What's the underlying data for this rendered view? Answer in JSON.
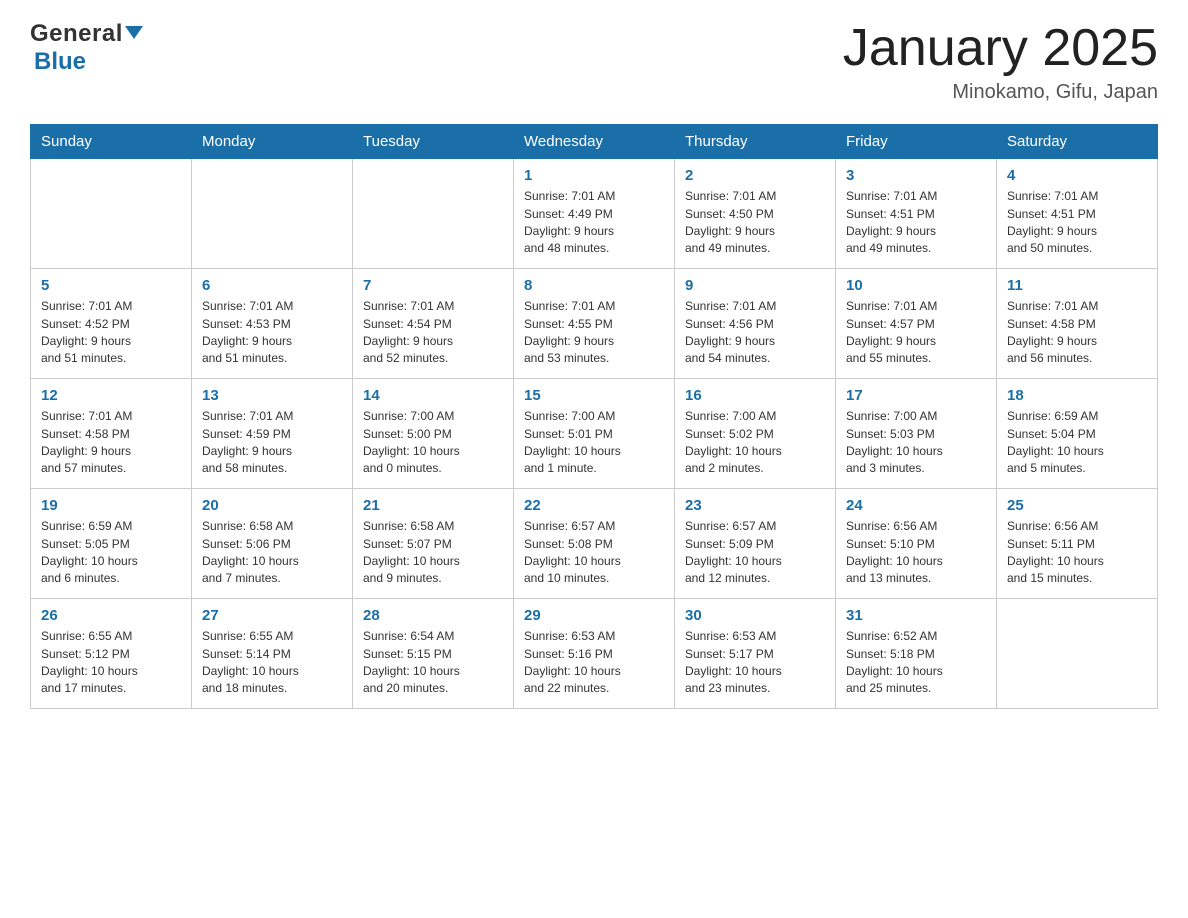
{
  "header": {
    "logo_general": "General",
    "logo_blue": "Blue",
    "title": "January 2025",
    "subtitle": "Minokamo, Gifu, Japan"
  },
  "days_of_week": [
    "Sunday",
    "Monday",
    "Tuesday",
    "Wednesday",
    "Thursday",
    "Friday",
    "Saturday"
  ],
  "weeks": [
    [
      {
        "day": "",
        "info": ""
      },
      {
        "day": "",
        "info": ""
      },
      {
        "day": "",
        "info": ""
      },
      {
        "day": "1",
        "info": "Sunrise: 7:01 AM\nSunset: 4:49 PM\nDaylight: 9 hours\nand 48 minutes."
      },
      {
        "day": "2",
        "info": "Sunrise: 7:01 AM\nSunset: 4:50 PM\nDaylight: 9 hours\nand 49 minutes."
      },
      {
        "day": "3",
        "info": "Sunrise: 7:01 AM\nSunset: 4:51 PM\nDaylight: 9 hours\nand 49 minutes."
      },
      {
        "day": "4",
        "info": "Sunrise: 7:01 AM\nSunset: 4:51 PM\nDaylight: 9 hours\nand 50 minutes."
      }
    ],
    [
      {
        "day": "5",
        "info": "Sunrise: 7:01 AM\nSunset: 4:52 PM\nDaylight: 9 hours\nand 51 minutes."
      },
      {
        "day": "6",
        "info": "Sunrise: 7:01 AM\nSunset: 4:53 PM\nDaylight: 9 hours\nand 51 minutes."
      },
      {
        "day": "7",
        "info": "Sunrise: 7:01 AM\nSunset: 4:54 PM\nDaylight: 9 hours\nand 52 minutes."
      },
      {
        "day": "8",
        "info": "Sunrise: 7:01 AM\nSunset: 4:55 PM\nDaylight: 9 hours\nand 53 minutes."
      },
      {
        "day": "9",
        "info": "Sunrise: 7:01 AM\nSunset: 4:56 PM\nDaylight: 9 hours\nand 54 minutes."
      },
      {
        "day": "10",
        "info": "Sunrise: 7:01 AM\nSunset: 4:57 PM\nDaylight: 9 hours\nand 55 minutes."
      },
      {
        "day": "11",
        "info": "Sunrise: 7:01 AM\nSunset: 4:58 PM\nDaylight: 9 hours\nand 56 minutes."
      }
    ],
    [
      {
        "day": "12",
        "info": "Sunrise: 7:01 AM\nSunset: 4:58 PM\nDaylight: 9 hours\nand 57 minutes."
      },
      {
        "day": "13",
        "info": "Sunrise: 7:01 AM\nSunset: 4:59 PM\nDaylight: 9 hours\nand 58 minutes."
      },
      {
        "day": "14",
        "info": "Sunrise: 7:00 AM\nSunset: 5:00 PM\nDaylight: 10 hours\nand 0 minutes."
      },
      {
        "day": "15",
        "info": "Sunrise: 7:00 AM\nSunset: 5:01 PM\nDaylight: 10 hours\nand 1 minute."
      },
      {
        "day": "16",
        "info": "Sunrise: 7:00 AM\nSunset: 5:02 PM\nDaylight: 10 hours\nand 2 minutes."
      },
      {
        "day": "17",
        "info": "Sunrise: 7:00 AM\nSunset: 5:03 PM\nDaylight: 10 hours\nand 3 minutes."
      },
      {
        "day": "18",
        "info": "Sunrise: 6:59 AM\nSunset: 5:04 PM\nDaylight: 10 hours\nand 5 minutes."
      }
    ],
    [
      {
        "day": "19",
        "info": "Sunrise: 6:59 AM\nSunset: 5:05 PM\nDaylight: 10 hours\nand 6 minutes."
      },
      {
        "day": "20",
        "info": "Sunrise: 6:58 AM\nSunset: 5:06 PM\nDaylight: 10 hours\nand 7 minutes."
      },
      {
        "day": "21",
        "info": "Sunrise: 6:58 AM\nSunset: 5:07 PM\nDaylight: 10 hours\nand 9 minutes."
      },
      {
        "day": "22",
        "info": "Sunrise: 6:57 AM\nSunset: 5:08 PM\nDaylight: 10 hours\nand 10 minutes."
      },
      {
        "day": "23",
        "info": "Sunrise: 6:57 AM\nSunset: 5:09 PM\nDaylight: 10 hours\nand 12 minutes."
      },
      {
        "day": "24",
        "info": "Sunrise: 6:56 AM\nSunset: 5:10 PM\nDaylight: 10 hours\nand 13 minutes."
      },
      {
        "day": "25",
        "info": "Sunrise: 6:56 AM\nSunset: 5:11 PM\nDaylight: 10 hours\nand 15 minutes."
      }
    ],
    [
      {
        "day": "26",
        "info": "Sunrise: 6:55 AM\nSunset: 5:12 PM\nDaylight: 10 hours\nand 17 minutes."
      },
      {
        "day": "27",
        "info": "Sunrise: 6:55 AM\nSunset: 5:14 PM\nDaylight: 10 hours\nand 18 minutes."
      },
      {
        "day": "28",
        "info": "Sunrise: 6:54 AM\nSunset: 5:15 PM\nDaylight: 10 hours\nand 20 minutes."
      },
      {
        "day": "29",
        "info": "Sunrise: 6:53 AM\nSunset: 5:16 PM\nDaylight: 10 hours\nand 22 minutes."
      },
      {
        "day": "30",
        "info": "Sunrise: 6:53 AM\nSunset: 5:17 PM\nDaylight: 10 hours\nand 23 minutes."
      },
      {
        "day": "31",
        "info": "Sunrise: 6:52 AM\nSunset: 5:18 PM\nDaylight: 10 hours\nand 25 minutes."
      },
      {
        "day": "",
        "info": ""
      }
    ]
  ]
}
